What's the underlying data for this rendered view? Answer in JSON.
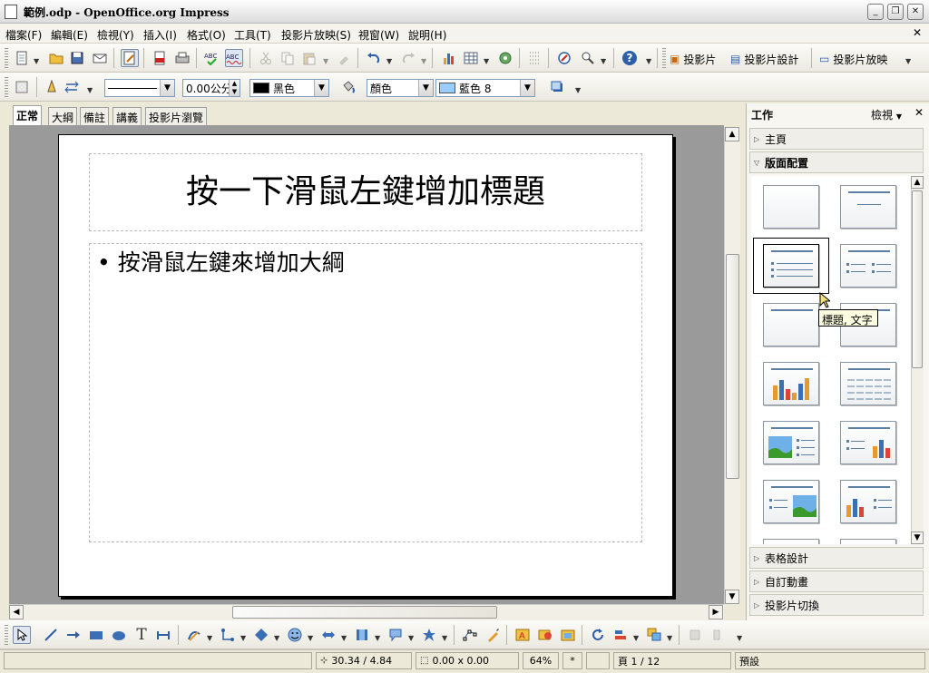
{
  "window": {
    "title": "範例.odp - OpenOffice.org Impress"
  },
  "menu": [
    "檔案(F)",
    "編輯(E)",
    "檢視(Y)",
    "插入(I)",
    "格式(O)",
    "工具(T)",
    "投影片放映(S)",
    "視窗(W)",
    "說明(H)"
  ],
  "toolbar": {
    "slide_label": "投影片",
    "slide_design_label": "投影片設計",
    "slideshow_label": "投影片放映"
  },
  "lineprops": {
    "line_width": "0.00公分",
    "line_color": "黑色",
    "area_style": "顏色",
    "area_color": "藍色 8"
  },
  "colors": {
    "line_color": "#000000",
    "area_color": "#99ccff",
    "accent": "#5c7fa3"
  },
  "view_tabs": [
    "正常",
    "大綱",
    "備註",
    "講義",
    "投影片瀏覽"
  ],
  "slide": {
    "title_placeholder": "按一下滑鼠左鍵增加標題",
    "outline_placeholder": "按滑鼠左鍵來增加大綱"
  },
  "taskpane": {
    "title": "工作",
    "view_label": "檢視",
    "sections": {
      "master": "主頁",
      "layouts": "版面配置",
      "table_design": "表格設計",
      "custom_animation": "自訂動畫",
      "slide_transition": "投影片切換"
    },
    "tooltip": "標題, 文字"
  },
  "status": {
    "position": "30.34 / 4.84",
    "size": "0.00 x 0.00",
    "zoom": "64%",
    "modified": "*",
    "page": "頁 1 / 12",
    "master": "預設"
  }
}
